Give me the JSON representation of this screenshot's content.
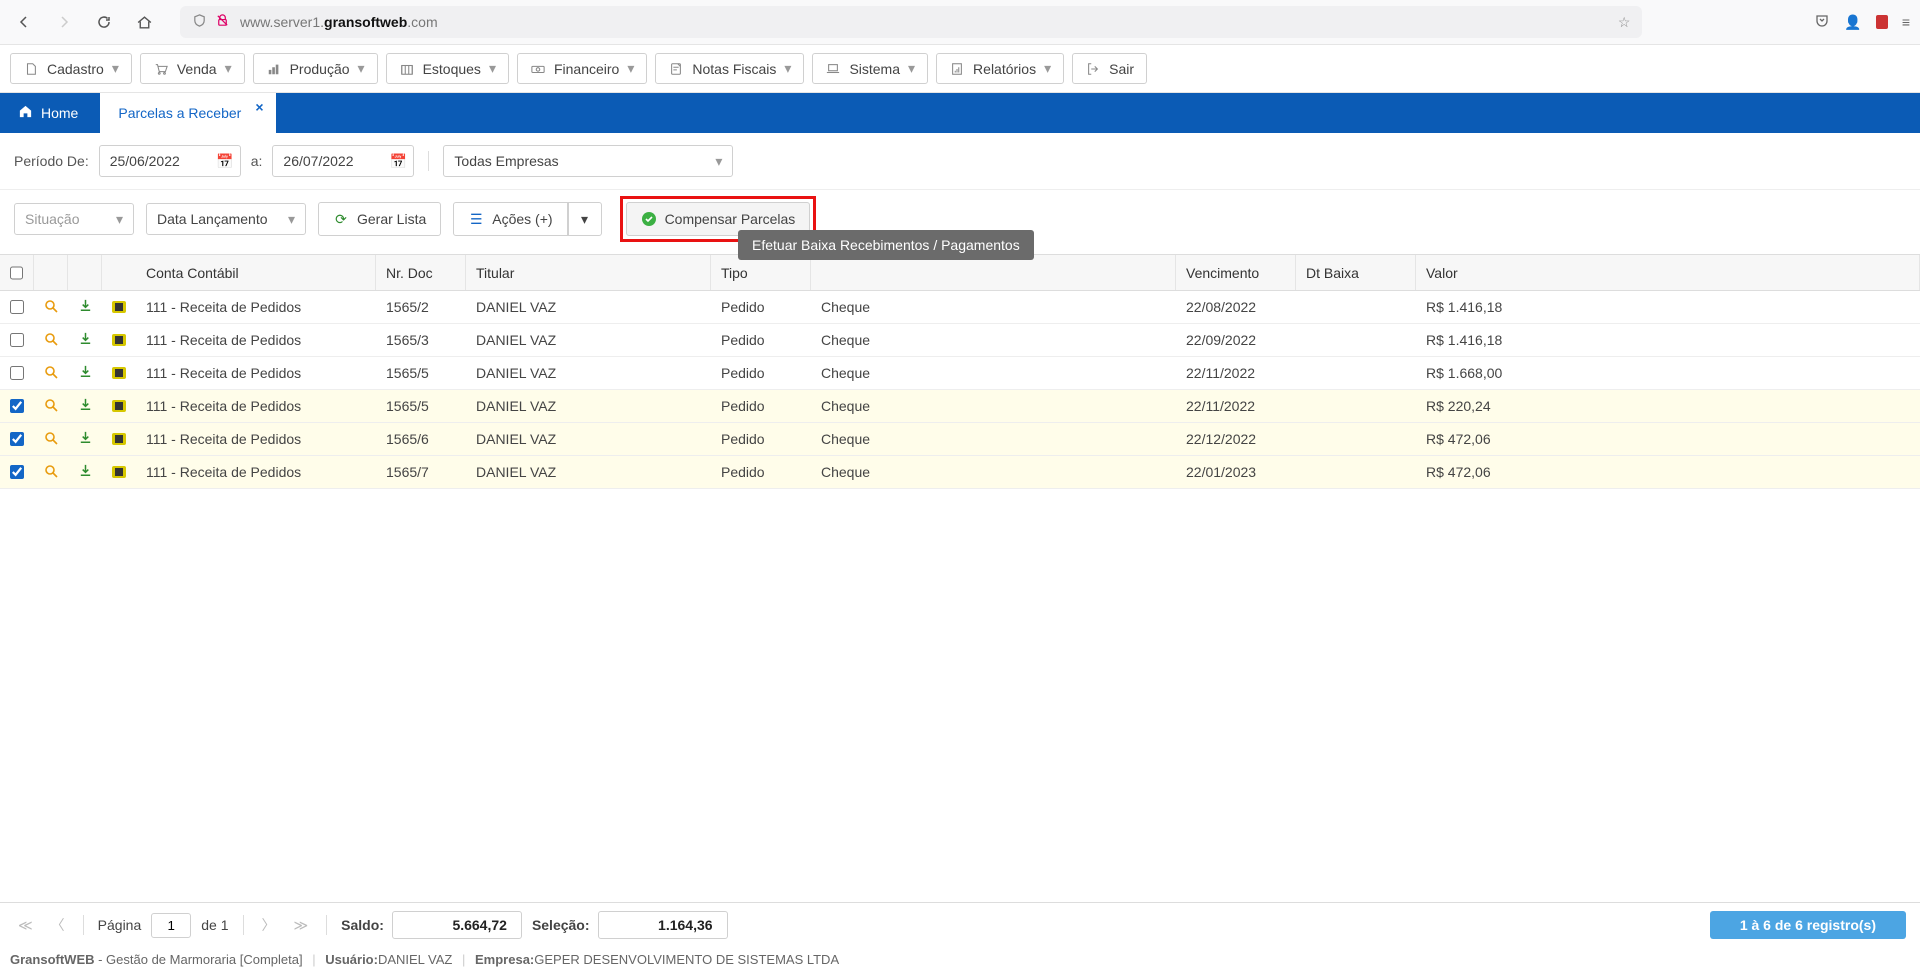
{
  "browser": {
    "url_prefix": "www.server1.",
    "url_domain": "gransoftweb",
    "url_suffix": ".com"
  },
  "menu": [
    {
      "icon": "file",
      "label": "Cadastro"
    },
    {
      "icon": "cart",
      "label": "Venda"
    },
    {
      "icon": "chart",
      "label": "Produção"
    },
    {
      "icon": "boxes",
      "label": "Estoques"
    },
    {
      "icon": "money",
      "label": "Financeiro"
    },
    {
      "icon": "doc",
      "label": "Notas Fiscais"
    },
    {
      "icon": "laptop",
      "label": "Sistema"
    },
    {
      "icon": "report",
      "label": "Relatórios"
    },
    {
      "icon": "exit",
      "label": "Sair",
      "no_caret": true
    }
  ],
  "tabs": {
    "home": "Home",
    "parcelas": "Parcelas a Receber"
  },
  "filters": {
    "periodo_label": "Período De:",
    "data_de": "25/06/2022",
    "a_label": "a:",
    "data_ate": "26/07/2022",
    "empresa": "Todas Empresas",
    "situacao": "Situação",
    "data_lanc": "Data Lançamento",
    "gerar": "Gerar Lista",
    "acoes": "Ações (+)",
    "compensar": "Compensar Parcelas"
  },
  "tooltip": "Efetuar Baixa Recebimentos / Pagamentos",
  "columns": {
    "conta": "Conta Contábil",
    "nrdoc": "Nr. Doc",
    "titular": "Titular",
    "tipo": "Tipo",
    "forma": "",
    "venc": "Vencimento",
    "baixa": "Dt Baixa",
    "valor": "Valor"
  },
  "rows": [
    {
      "checked": false,
      "conta": "111 - Receita de Pedidos",
      "nrdoc": "1565/2",
      "titular": "DANIEL VAZ",
      "tipo": "Pedido",
      "forma": "Cheque",
      "venc": "22/08/2022",
      "baixa": "",
      "valor": "R$ 1.416,18"
    },
    {
      "checked": false,
      "conta": "111 - Receita de Pedidos",
      "nrdoc": "1565/3",
      "titular": "DANIEL VAZ",
      "tipo": "Pedido",
      "forma": "Cheque",
      "venc": "22/09/2022",
      "baixa": "",
      "valor": "R$ 1.416,18"
    },
    {
      "checked": false,
      "conta": "111 - Receita de Pedidos",
      "nrdoc": "1565/5",
      "titular": "DANIEL VAZ",
      "tipo": "Pedido",
      "forma": "Cheque",
      "venc": "22/11/2022",
      "baixa": "",
      "valor": "R$ 1.668,00"
    },
    {
      "checked": true,
      "conta": "111 - Receita de Pedidos",
      "nrdoc": "1565/5",
      "titular": "DANIEL VAZ",
      "tipo": "Pedido",
      "forma": "Cheque",
      "venc": "22/11/2022",
      "baixa": "",
      "valor": "R$ 220,24"
    },
    {
      "checked": true,
      "conta": "111 - Receita de Pedidos",
      "nrdoc": "1565/6",
      "titular": "DANIEL VAZ",
      "tipo": "Pedido",
      "forma": "Cheque",
      "venc": "22/12/2022",
      "baixa": "",
      "valor": "R$ 472,06"
    },
    {
      "checked": true,
      "conta": "111 - Receita de Pedidos",
      "nrdoc": "1565/7",
      "titular": "DANIEL VAZ",
      "tipo": "Pedido",
      "forma": "Cheque",
      "venc": "22/01/2023",
      "baixa": "",
      "valor": "R$ 472,06"
    }
  ],
  "footer": {
    "pagina_label": "Página",
    "page": "1",
    "de_label": "de 1",
    "saldo_label": "Saldo:",
    "saldo_val": "5.664,72",
    "selecao_label": "Seleção:",
    "selecao_val": "1.164,36",
    "records": "1 à 6 de 6 registro(s)"
  },
  "status": {
    "app": "GransoftWEB",
    "desc": " - Gestão de Marmoraria [Completa]",
    "usuario_label": "Usuário:",
    "usuario": "DANIEL VAZ",
    "empresa_label": "Empresa:",
    "empresa": "GEPER DESENVOLVIMENTO DE SISTEMAS LTDA"
  }
}
